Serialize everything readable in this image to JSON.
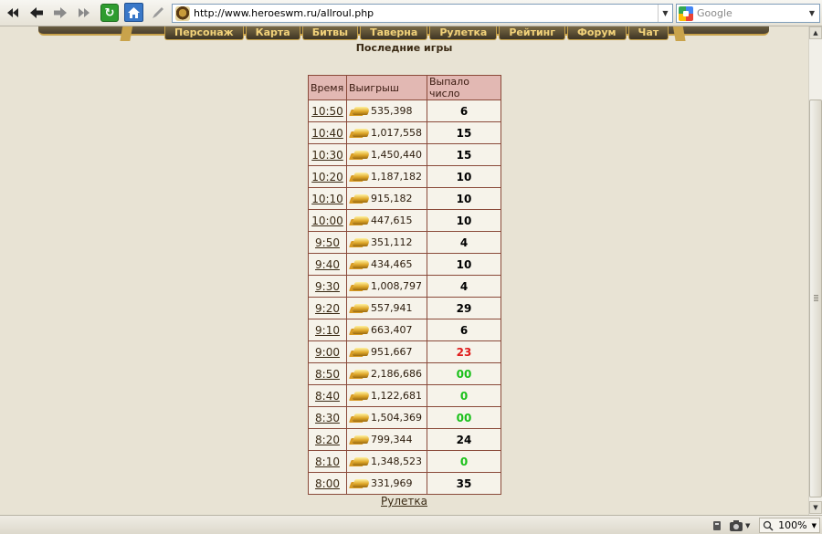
{
  "browser": {
    "url": "http://www.heroeswm.ru/allroul.php",
    "search_placeholder": "Google",
    "zoom": "100%"
  },
  "nav": {
    "items": [
      "Персонаж",
      "Карта",
      "Битвы",
      "Таверна",
      "Рулетка",
      "Рейтинг",
      "Форум",
      "Чат"
    ]
  },
  "page": {
    "title": "Последние игры",
    "table": {
      "headers": [
        "Время",
        "Выигрыш",
        "Выпало число"
      ],
      "rows": [
        {
          "time": "10:50",
          "win": "535,398",
          "number": "6",
          "color": "#000000"
        },
        {
          "time": "10:40",
          "win": "1,017,558",
          "number": "15",
          "color": "#000000"
        },
        {
          "time": "10:30",
          "win": "1,450,440",
          "number": "15",
          "color": "#000000"
        },
        {
          "time": "10:20",
          "win": "1,187,182",
          "number": "10",
          "color": "#000000"
        },
        {
          "time": "10:10",
          "win": "915,182",
          "number": "10",
          "color": "#000000"
        },
        {
          "time": "10:00",
          "win": "447,615",
          "number": "10",
          "color": "#000000"
        },
        {
          "time": "9:50",
          "win": "351,112",
          "number": "4",
          "color": "#000000"
        },
        {
          "time": "9:40",
          "win": "434,465",
          "number": "10",
          "color": "#000000"
        },
        {
          "time": "9:30",
          "win": "1,008,797",
          "number": "4",
          "color": "#000000"
        },
        {
          "time": "9:20",
          "win": "557,941",
          "number": "29",
          "color": "#000000"
        },
        {
          "time": "9:10",
          "win": "663,407",
          "number": "6",
          "color": "#000000"
        },
        {
          "time": "9:00",
          "win": "951,667",
          "number": "23",
          "color": "#e01b1b"
        },
        {
          "time": "8:50",
          "win": "2,186,686",
          "number": "00",
          "color": "#19c019"
        },
        {
          "time": "8:40",
          "win": "1,122,681",
          "number": "0",
          "color": "#19c019"
        },
        {
          "time": "8:30",
          "win": "1,504,369",
          "number": "00",
          "color": "#19c019"
        },
        {
          "time": "8:20",
          "win": "799,344",
          "number": "24",
          "color": "#000000"
        },
        {
          "time": "8:10",
          "win": "1,348,523",
          "number": "0",
          "color": "#19c019"
        },
        {
          "time": "8:00",
          "win": "331,969",
          "number": "35",
          "color": "#000000"
        }
      ]
    },
    "bottom_link": "Рулетка"
  },
  "icons": {
    "back_double": "⏮",
    "back": "⇦",
    "forward": "⇨",
    "forward_double": "⏭",
    "reload": "↻",
    "home": "⌂"
  }
}
